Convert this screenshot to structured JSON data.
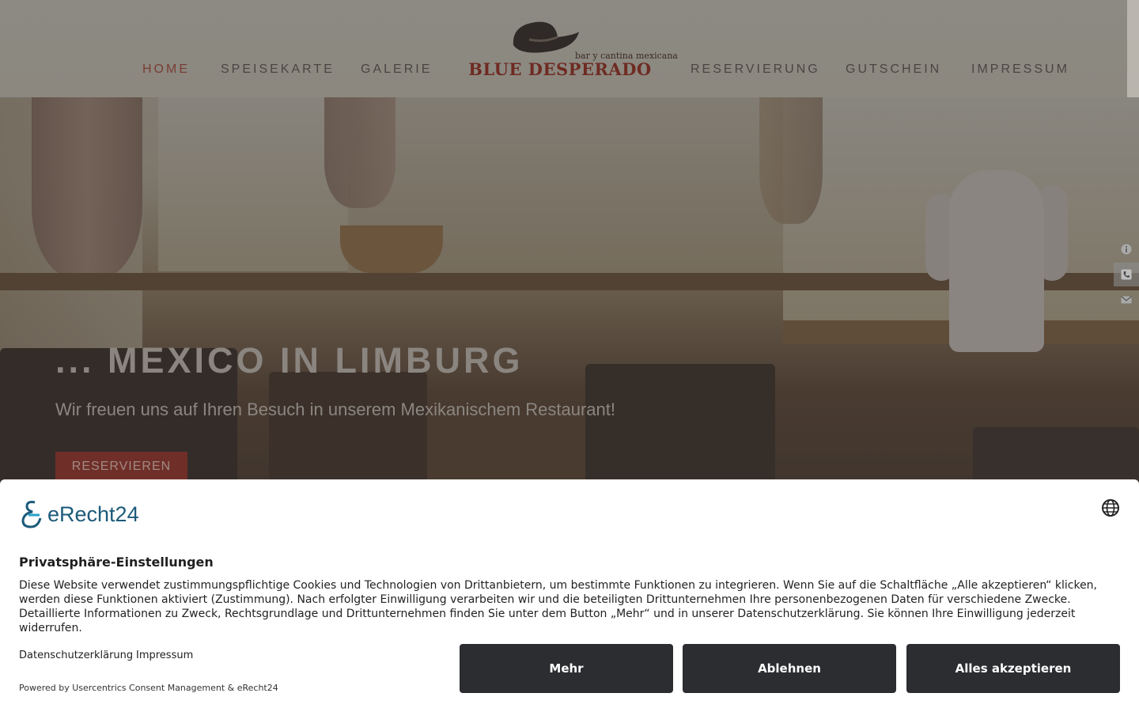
{
  "nav": {
    "items": [
      {
        "label": "HOME",
        "active": true
      },
      {
        "label": "SPEISEKARTE"
      },
      {
        "label": "GALERIE"
      },
      {
        "label": "RESERVIERUNG"
      },
      {
        "label": "GUTSCHEIN"
      },
      {
        "label": "IMPRESSUM"
      }
    ],
    "logo_title": "BLUE DESPERADO",
    "logo_subtitle": "bar y cantina mexicana"
  },
  "hero": {
    "title": "... MEXICO IN LIMBURG",
    "subtitle": "Wir freuen uns auf Ihren Besuch in unserem Mexikanischem Restaurant!",
    "button_label": "RESERVIEREN"
  },
  "side_icons": [
    "info-icon",
    "phone-icon",
    "mail-icon"
  ],
  "consent": {
    "brand": "eRecht24",
    "title": "Privatsphäre-Einstellungen",
    "text": "Diese Website verwendet zustimmungspflichtige Cookies und Technologien von Drittanbietern, um bestimmte Funktionen zu integrieren. Wenn Sie auf die Schaltfläche „Alle akzeptieren“ klicken, werden diese Funktionen aktiviert (Zustimmung). Nach erfolgter Einwilligung verarbeiten wir und die beteiligten Drittunternehmen Ihre personenbezogenen Daten für verschiedene Zwecke. Detaillierte Informationen zu Zweck, Rechtsgrundlage und Drittunternehmen finden Sie unter dem Button „Mehr“ und in unserer Datenschutzerklärung. Sie können Ihre Einwilligung jederzeit widerrufen.",
    "link_privacy": "Datenschutzerklärung",
    "link_imprint": "Impressum",
    "powered_by": "Powered by Usercentrics Consent Management & eRecht24",
    "btn_more": "Mehr",
    "btn_decline": "Ablehnen",
    "btn_accept": "Alles akzeptieren"
  },
  "colors": {
    "nav_active": "#7a3d32",
    "button_dark": "#2b2d31",
    "brand_blue": "#1c5a7a"
  }
}
